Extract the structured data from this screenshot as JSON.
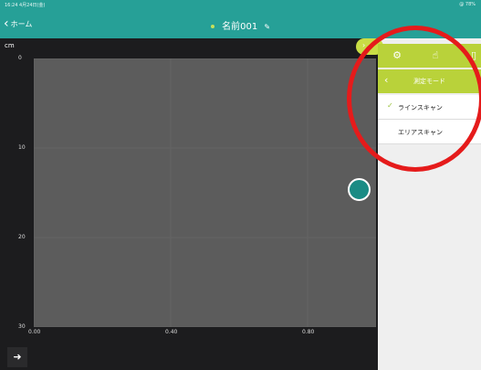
{
  "status": {
    "time": "16:24 4月24日(金)",
    "battery": "@ 78%"
  },
  "nav": {
    "back_label": "ホーム",
    "title": "名前001"
  },
  "panel": {
    "pill_icon": "chevron-right",
    "tools": [
      "gear-icon",
      "hand-icon",
      "panel-icon"
    ],
    "mode_title": "測定モード",
    "items": [
      {
        "label": "ラインスキャン",
        "selected": true
      },
      {
        "label": "エリアスキャン",
        "selected": false
      }
    ]
  },
  "chart_data": {
    "type": "scatter",
    "y_unit": "cm",
    "y_ticks": [
      "0",
      "10",
      "20",
      "30"
    ],
    "x_ticks": [
      "0.00",
      "0.40",
      "0.80"
    ],
    "xlim": [
      0,
      1
    ],
    "ylim": [
      0,
      30
    ],
    "points": [
      {
        "x": 0.96,
        "y": 15
      }
    ],
    "colors": {
      "plot_bg": "#5c5c5c",
      "marker": "#1a8b84",
      "accent": "#b9d23a",
      "header": "#26a097"
    }
  }
}
